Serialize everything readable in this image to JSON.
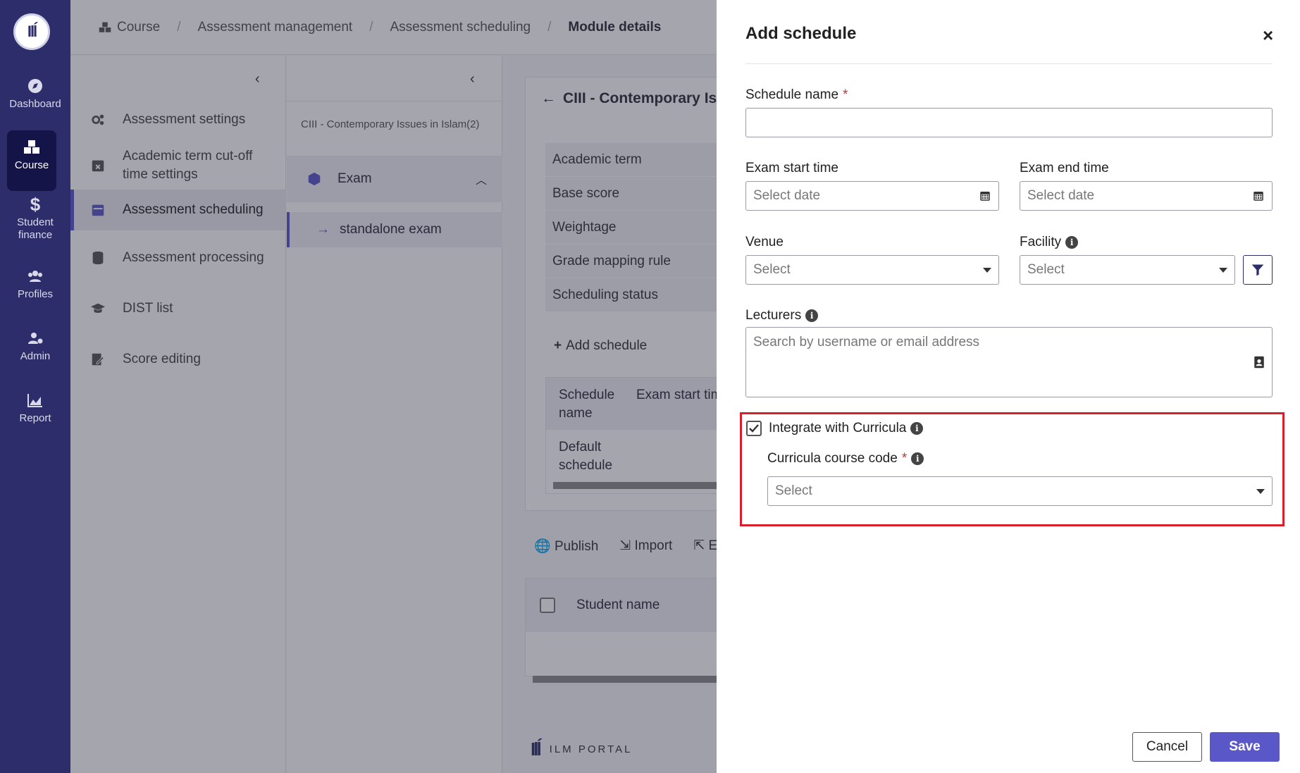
{
  "rail": {
    "items": [
      {
        "label": "Dashboard"
      },
      {
        "label": "Course"
      },
      {
        "label": "Student finance"
      },
      {
        "label": "Profiles"
      },
      {
        "label": "Admin"
      },
      {
        "label": "Report"
      }
    ]
  },
  "breadcrumb": [
    "Course",
    "Assessment management",
    "Assessment scheduling",
    "Module details"
  ],
  "settings_menu": [
    "Assessment settings",
    "Academic term cut-off time settings",
    "Assessment scheduling",
    "Assessment processing",
    "DIST list",
    "Score editing"
  ],
  "tree": {
    "module": "CIII - Contemporary Issues in Islam(2)",
    "exam": "Exam",
    "sub": "standalone exam"
  },
  "detail": {
    "title": "CIII - Contemporary Issues in Islam",
    "props": [
      "Academic term",
      "Base score",
      "Weightage",
      "Grade mapping rule",
      "Scheduling status"
    ],
    "add_schedule": "Add schedule",
    "table_headers": [
      "Schedule name",
      "Exam start time"
    ],
    "table_rows": [
      [
        "Default schedule",
        ""
      ]
    ],
    "actions": [
      "Publish",
      "Import",
      "E"
    ],
    "student_header": "Student name"
  },
  "footer": {
    "brand": "ILM PORTAL"
  },
  "drawer": {
    "title": "Add schedule",
    "schedule_name": {
      "label": "Schedule name",
      "value": "",
      "placeholder": ""
    },
    "exam_start": {
      "label": "Exam start time",
      "placeholder": "Select date"
    },
    "exam_end": {
      "label": "Exam end time",
      "placeholder": "Select date"
    },
    "venue": {
      "label": "Venue",
      "value": "Select"
    },
    "facility": {
      "label": "Facility",
      "value": "Select"
    },
    "lecturers": {
      "label": "Lecturers",
      "placeholder": "Search by username or email address"
    },
    "integrate": {
      "label": "Integrate with Curricula",
      "checked": true
    },
    "course_code": {
      "label": "Curricula course code",
      "value": "Select"
    },
    "cancel_label": "Cancel",
    "save_label": "Save"
  },
  "colors": {
    "rail": "#2e2d6b",
    "accent": "#5a57c8",
    "highlight": "#d8202a"
  }
}
